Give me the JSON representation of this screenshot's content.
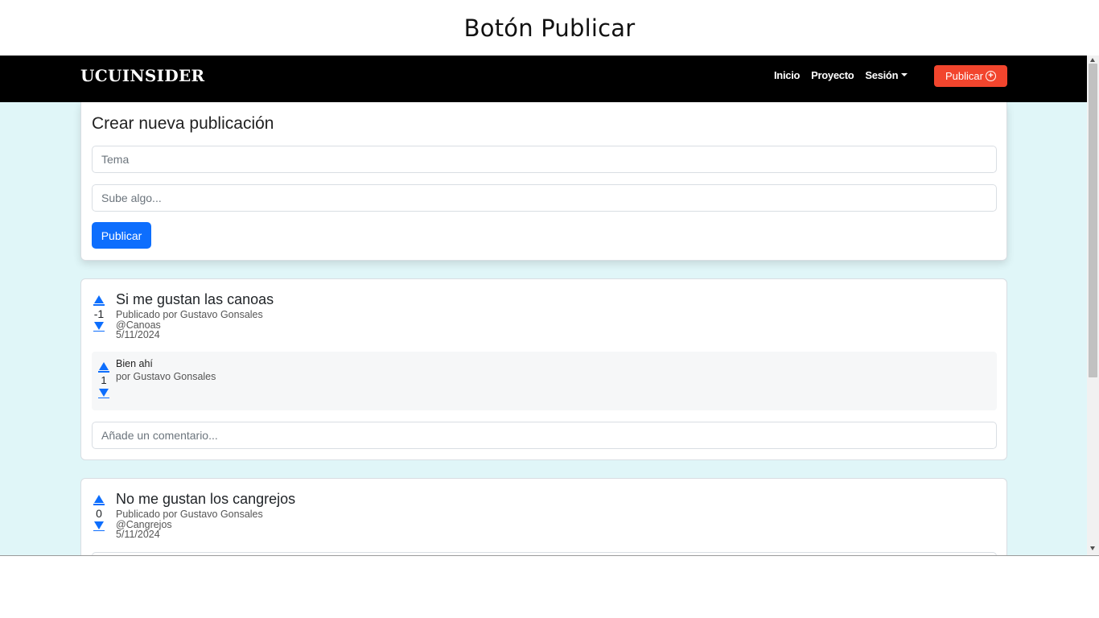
{
  "slide_title": "Botón Publicar",
  "navbar": {
    "brand": "UCUINSIDER",
    "links": [
      "Inicio",
      "Proyecto",
      "Sesión"
    ],
    "publish_button": "Publicar",
    "publish_icon": "plus-circle-icon"
  },
  "create_post": {
    "title": "Crear nueva publicación",
    "topic_placeholder": "Tema",
    "content_placeholder": "Sube algo...",
    "submit_label": "Publicar"
  },
  "posts": [
    {
      "votes": "-1",
      "title": "Si me gustan las canoas",
      "author_line": "Publicado por Gustavo Gonsales",
      "tag": "@Canoas",
      "date": "5/11/2024",
      "comments": [
        {
          "votes": "1",
          "text": "Bien ahí",
          "author_line": "por Gustavo Gonsales"
        }
      ],
      "comment_placeholder": "Añade un comentario..."
    },
    {
      "votes": "0",
      "title": "No me gustan los cangrejos",
      "author_line": "Publicado por Gustavo Gonsales",
      "tag": "@Cangrejos",
      "date": "5/11/2024"
    }
  ],
  "colors": {
    "navbar_bg": "#000000",
    "publish_nav_bg": "#f2452d",
    "primary": "#0d6efd",
    "page_bg": "#e0f6f8"
  }
}
